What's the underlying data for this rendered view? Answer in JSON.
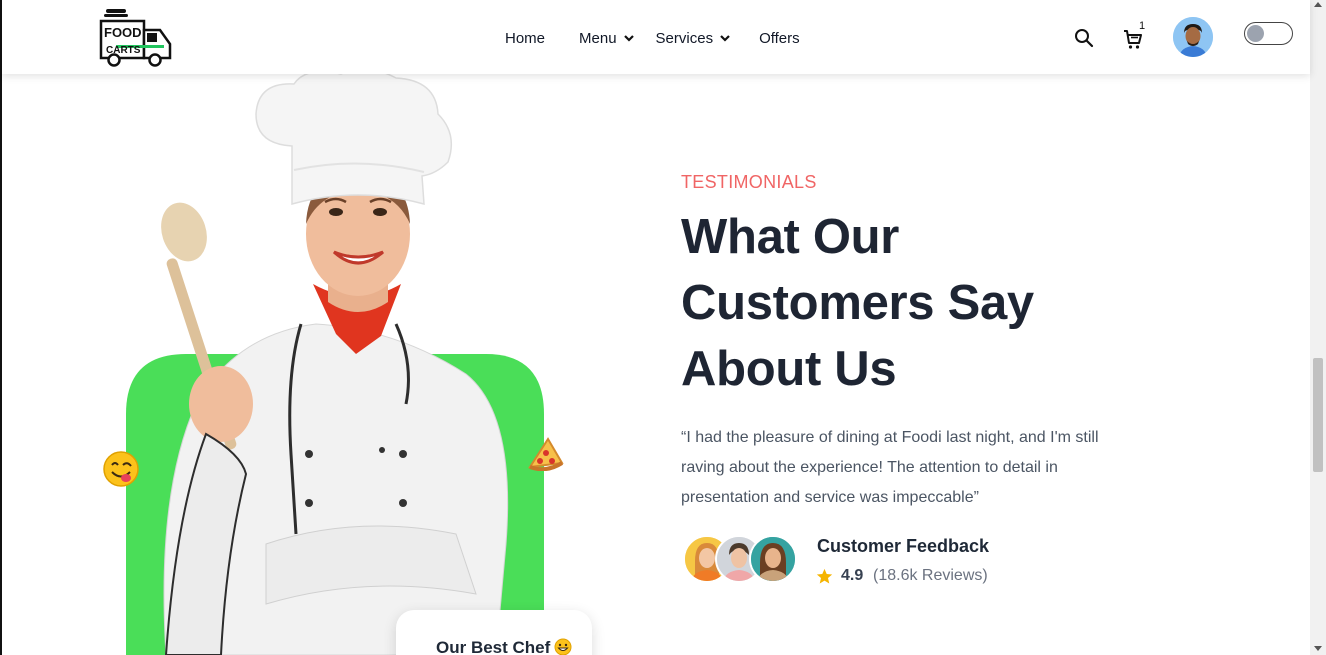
{
  "brand": {
    "logo_line1": "FOOD",
    "logo_line2": "CARTS",
    "logo_icon": "food-truck-icon"
  },
  "nav": {
    "items": [
      {
        "label": "Home",
        "has_dropdown": false
      },
      {
        "label": "Menu",
        "has_dropdown": true
      },
      {
        "label": "Services",
        "has_dropdown": true
      },
      {
        "label": "Offers",
        "has_dropdown": false
      }
    ]
  },
  "header_actions": {
    "search_icon": "search-icon",
    "cart_icon": "cart-icon",
    "cart_count": "1",
    "avatar_icon": "user-avatar",
    "theme_toggle_on": false
  },
  "hero": {
    "badge_label": "Our Best Chef",
    "badge_emoji": "grinning-emoji-icon",
    "decor_left": "yum-face-emoji",
    "decor_right": "pizza-emoji",
    "accent_color": "#4ade58"
  },
  "testimonials": {
    "eyebrow": "TESTIMONIALS",
    "title": "What Our Customers Say About Us",
    "quote": "“I had the pleasure of dining at Foodi last night, and I'm still raving about the experience! The attention to detail in presentation and service was impeccable”",
    "feedback_title": "Customer Feedback",
    "rating": "4.9",
    "reviews": "(18.6k Reviews)",
    "eyebrow_color": "#f06565",
    "star_color": "#f5b400"
  }
}
